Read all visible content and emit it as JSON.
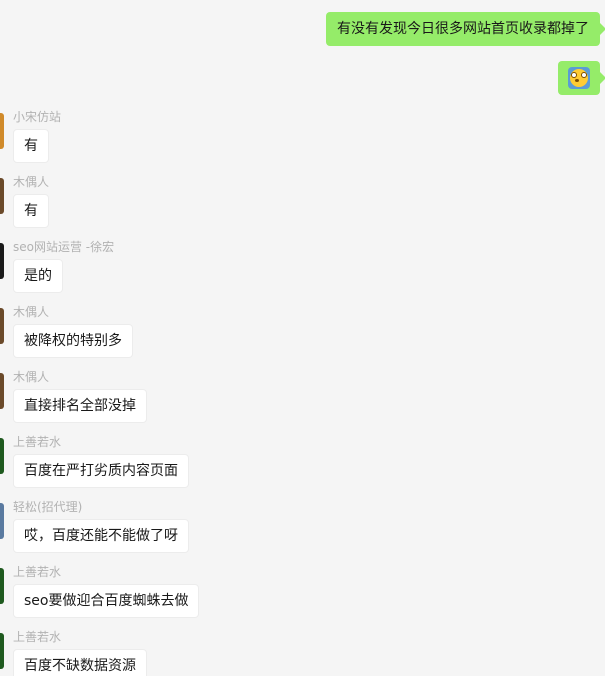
{
  "outgoing": [
    {
      "text": "有没有发现今日很多网站首页收录都掉了"
    },
    {
      "emoji": "flushed-face-emoji"
    }
  ],
  "messages": [
    {
      "sender": "小宋仿站",
      "text": "有",
      "avatar_color": "#d08a2a"
    },
    {
      "sender": "木偶人",
      "text": "有",
      "avatar_color": "#6b4a2a"
    },
    {
      "sender": "seo网站运营 -徐宏",
      "text": "是的",
      "avatar_color": "#1a1a1a"
    },
    {
      "sender": "木偶人",
      "text": "被降权的特别多",
      "avatar_color": "#6b4a2a"
    },
    {
      "sender": "木偶人",
      "text": "直接排名全部没掉",
      "avatar_color": "#6b4a2a"
    },
    {
      "sender": "上善若水",
      "text": "百度在严打劣质内容页面",
      "avatar_color": "#1f5a1f"
    },
    {
      "sender": "轻松(招代理)",
      "text": "哎，百度还能不能做了呀",
      "avatar_color": "#5a7aa0"
    },
    {
      "sender": "上善若水",
      "text": "seo要做迎合百度蜘蛛去做",
      "avatar_color": "#1f5a1f"
    },
    {
      "sender": "上善若水",
      "text": "百度不缺数据资源",
      "avatar_color": "#1f5a1f"
    }
  ]
}
